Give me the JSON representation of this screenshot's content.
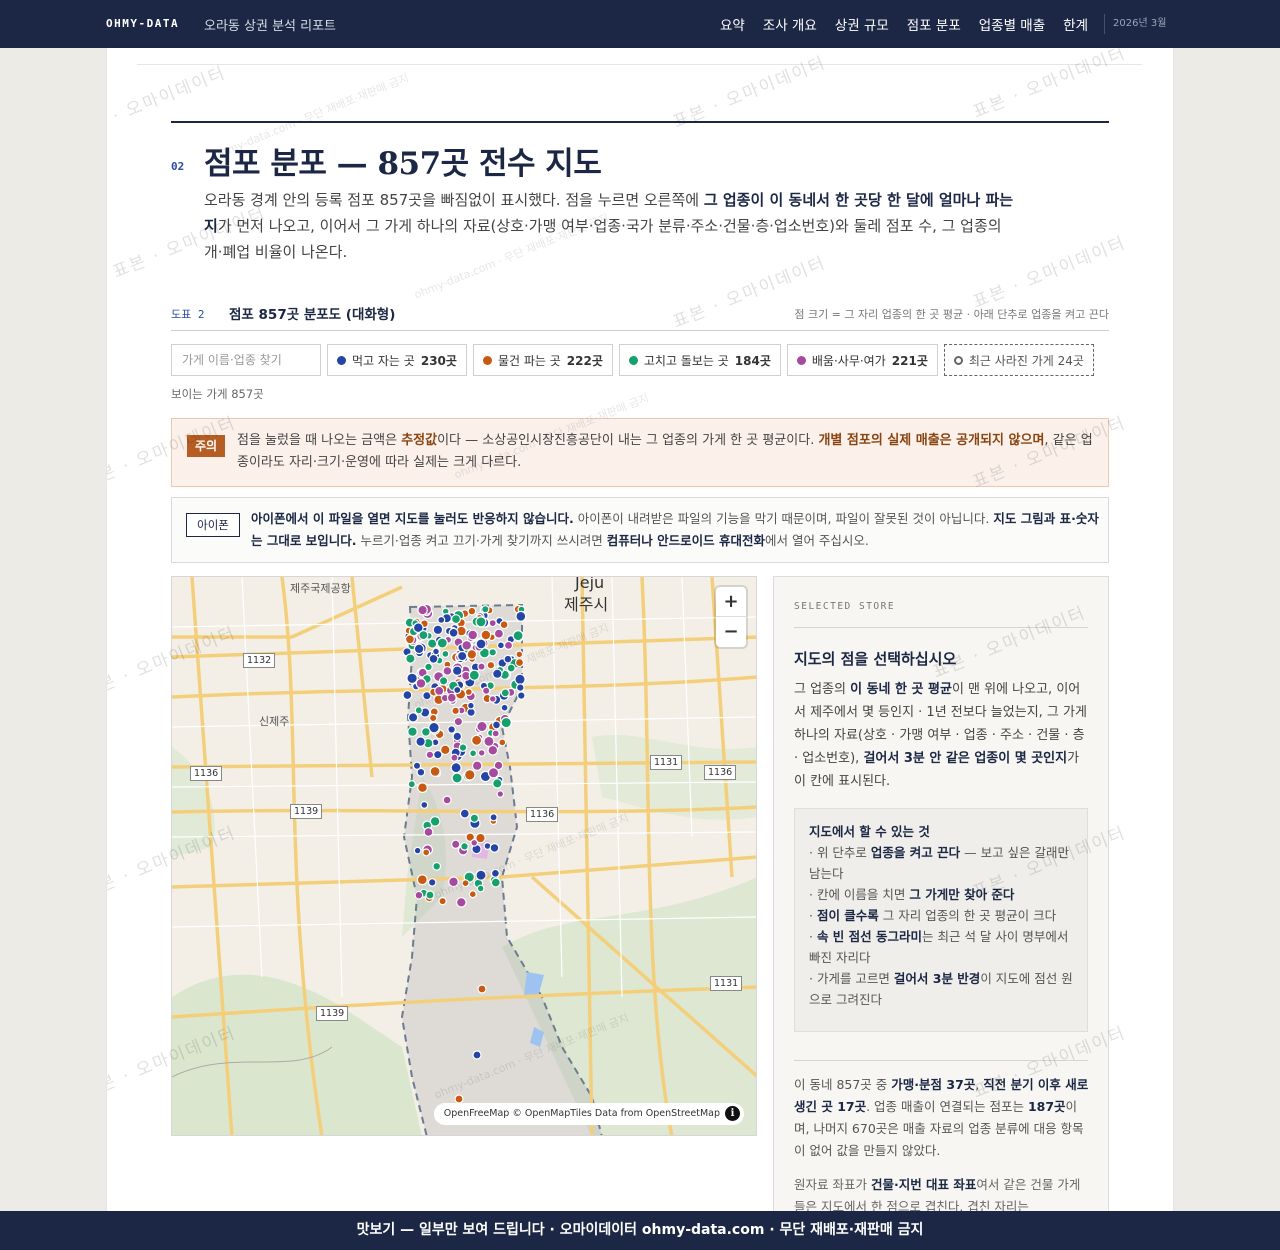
{
  "nav": {
    "brand": "OHMY-DATA",
    "subtitle": "오라동 상권 분석 리포트",
    "links": [
      "요약",
      "조사 개요",
      "상권 규모",
      "점포 분포",
      "업종별 매출",
      "한계"
    ],
    "date": "2026년 3월"
  },
  "section": {
    "number": "02",
    "title": "점포 분포 — 857곳 전수 지도",
    "intro_1": "오라동 경계 안의 등록 점포 857곳을 빠짐없이 표시했다. 점을 누르면 오른쪽에 ",
    "intro_bold": "그 업종이 이 동네서 한 곳당 한 달에 얼마나 파는지",
    "intro_2": "가 먼저 나오고, 이어서 그 가게 하나의 자료(상호·가맹 여부·업종·국가 분류·주소·건물·층·업소번호)와 둘레 점포 수, 그 업종의 개·폐업 비율이 나온다."
  },
  "figure": {
    "tag": "도표 2",
    "title": "점포 857곳 분포도 (대화형)",
    "note": "점 크기 = 그 자리 업종의 한 곳 평균 · 아래 단추로 업종을 켜고 끈다"
  },
  "controls": {
    "search_placeholder": "가게 이름·업종 찾기",
    "chips": [
      {
        "label": "먹고 자는 곳",
        "count": "230곳",
        "color": "#2545a6"
      },
      {
        "label": "물건 파는 곳",
        "count": "222곳",
        "color": "#c75a12"
      },
      {
        "label": "고치고 돌보는 곳",
        "count": "184곳",
        "color": "#16a06d"
      },
      {
        "label": "배움·사무·여가",
        "count": "221곳",
        "color": "#a54a9f"
      }
    ],
    "closed_chip": "최근 사라진 가게 24곳",
    "visible_count": "보이는 가게 857곳"
  },
  "caution": {
    "badge": "주의",
    "text_1": "점을 눌렀을 때 나오는 금액은 ",
    "bold_1": "추정값",
    "text_2": "이다 — 소상공인시장진흥공단이 내는 그 업종의 가게 한 곳 평균이다. ",
    "bold_2": "개별 점포의 실제 매출은 공개되지 않으며",
    "text_3": ", 같은 업종이라도 자리·크기·운영에 따라 실제는 크게 다르다."
  },
  "iphone": {
    "badge": "아이폰",
    "bold_1": "아이폰에서 이 파일을 열면 지도를 눌러도 반응하지 않습니다.",
    "text_1": " 아이폰이 내려받은 파일의 기능을 막기 때문이며, 파일이 잘못된 것이 아닙니다. ",
    "bold_2": "지도 그림과 표·숫자는 그대로 보입니다.",
    "text_2": " 누르기·업종 켜고 끄기·가게 찾기까지 쓰시려면 ",
    "bold_3": "컴퓨터나 안드로이드 휴대전화",
    "text_3": "에서 열어 주십시오."
  },
  "map": {
    "labels": {
      "airport": "제주국제공항",
      "city_en": "Jeju",
      "city_ko": "제주시",
      "district": "신제주"
    },
    "roads": [
      "1132",
      "1136",
      "1139",
      "1136",
      "1131",
      "1136",
      "1131",
      "1139"
    ],
    "zoom_in": "+",
    "zoom_out": "−",
    "attribution": "OpenFreeMap © OpenMapTiles Data from OpenStreetMap",
    "info": "i"
  },
  "side": {
    "kicker": "SELECTED STORE",
    "title": "지도의 점을 선택하십시오",
    "body_1": "그 업종의 ",
    "body_b1": "이 동네 한 곳 평균",
    "body_2": "이 맨 위에 나오고, 이어서 제주에서 몇 등인지 · 1년 전보다 늘었는지, 그 가게 하나의 자료(상호 · 가맹 여부 · 업종 · 주소 · 건물 · 층 · 업소번호), ",
    "body_b2": "걸어서 3분 안 같은 업종이 몇 곳인지",
    "body_3": "가 이 칸에 표시된다.",
    "howto_title": "지도에서 할 수 있는 것",
    "howto": [
      {
        "pre": "· 위 단추로 ",
        "b": "업종을 켜고 끈다",
        "post": " — 보고 싶은 갈래만 남는다"
      },
      {
        "pre": "· 칸에 이름을 치면 ",
        "b": "그 가게만 찾아 준다",
        "post": ""
      },
      {
        "pre": "· ",
        "b": "점이 클수록",
        "post": " 그 자리 업종의 한 곳 평균이 크다"
      },
      {
        "pre": "· ",
        "b": "속 빈 점선 동그라미",
        "post": "는 최근 석 달 사이 명부에서 빠진 자리다"
      },
      {
        "pre": "· 가게를 고르면 ",
        "b": "걸어서 3분 반경",
        "post": "이 지도에 점선 원으로 그려진다"
      }
    ],
    "stats_1": "이 동네 857곳 중 ",
    "stats_b1": "가맹·분점 37곳",
    "stats_2": ", ",
    "stats_b2": "직전 분기 이후 새로 생긴 곳 17곳",
    "stats_3": ". 업종 매출이 연결되는 점포는 ",
    "stats_b3": "187곳",
    "stats_4": "이며, 나머지 670곳은 매출 자료의 업종 분류에 대응 항목이 없어 값을 만들지 않았다.",
    "note_1": "원자료 좌표가 ",
    "note_b1": "건물·지번 대표 좌표",
    "note_2": "여서 같은 건물 가게들은 지도에서 한 점으로 겹친다. 겹친 자리는"
  },
  "watermark": {
    "main": "표본 · 오마이데이터",
    "sub": "ohmy-data.com · 무단 재배포·재판매 금지"
  },
  "footer": "맛보기 — 일부만 보여 드립니다 · 오마이데이터 ohmy-data.com · 무단 재배포·재판매 금지"
}
